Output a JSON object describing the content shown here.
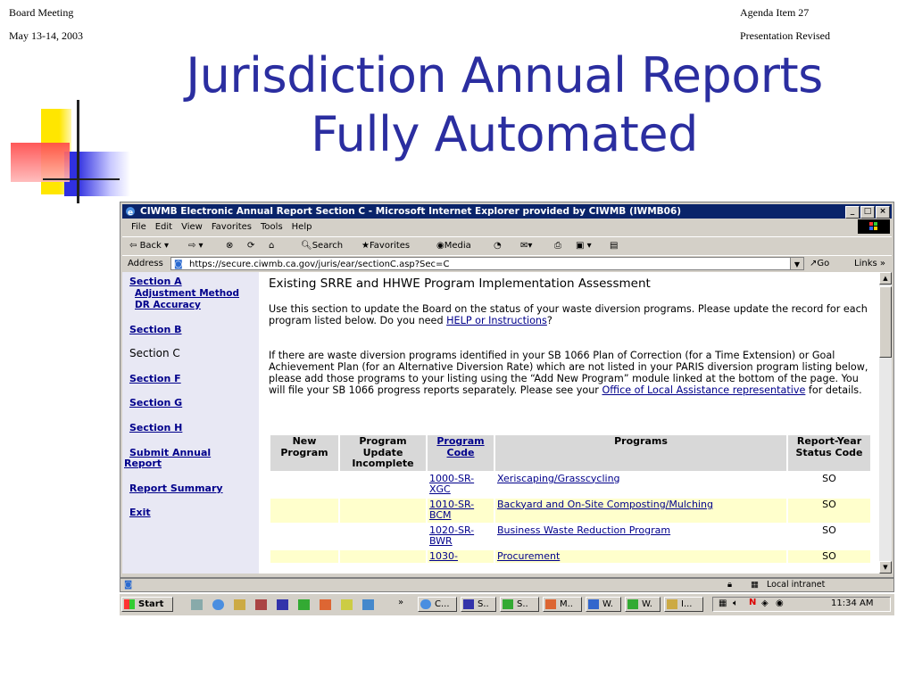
{
  "slide": {
    "header_left_line1": "Board Meeting",
    "header_left_line2": "May 13-14, 2003",
    "header_right_line1": "Agenda Item 27",
    "header_right_line2": "Presentation Revised",
    "title_line1": "Jurisdiction Annual Reports",
    "title_line2": "Fully Automated"
  },
  "colors": {
    "title": "#2b2ea0",
    "deco_yellow": "#ffe600",
    "deco_red": "#ff4a4a",
    "deco_blue": "#3030e0",
    "ie_titlebar": "#0a246a",
    "table_alt_row": "#ffffcc"
  },
  "browser": {
    "title": "CIWMB Electronic Annual Report Section C - Microsoft Internet Explorer provided by CIWMB (IWMB06)",
    "menu": [
      "File",
      "Edit",
      "View",
      "Favorites",
      "Tools",
      "Help"
    ],
    "toolbar": {
      "back": "Back",
      "search": "Search",
      "favorites": "Favorites",
      "media": "Media"
    },
    "address_label": "Address",
    "url": "https://secure.ciwmb.ca.gov/juris/ear/sectionC.asp?Sec=C",
    "go": "Go",
    "links": "Links"
  },
  "nav": {
    "section_a": "Section A",
    "adjustment_method": "Adjustment Method",
    "dr_accuracy": "DR Accuracy",
    "section_b": "Section B",
    "section_c": "Section C",
    "section_f": "Section F",
    "section_g": "Section G",
    "section_h": "Section H",
    "submit_line1": "Submit Annual",
    "submit_line2": "Report",
    "report_summary": "Report Summary",
    "exit": "Exit"
  },
  "main": {
    "heading": "Existing SRRE and HHWE Program Implementation Assessment",
    "p1_text": "Use this section to update the Board on the status of your waste diversion programs. Please update the record for each program listed below. Do you need ",
    "p1_link": "HELP or Instructions",
    "p1_end": "?",
    "p2_text": "If there are waste diversion programs identified in your SB 1066 Plan of Correction (for a Time Extension) or Goal Achievement Plan (for an Alternative Diversion Rate) which are not listed in your PARIS diversion program listing below, please add those programs to your listing using the “Add New Program” module linked at the bottom of the page. You will file your SB 1066 progress reports separately. Please see your ",
    "p2_link": "Office of Local Assistance representative",
    "p2_end": " for details."
  },
  "table": {
    "headers": [
      "New Program",
      "Program Update Incomplete",
      "Program Code",
      "Programs",
      "Report-Year Status Code"
    ],
    "rows": [
      {
        "code": "1000-SR-XGC",
        "program": "Xeriscaping/Grasscycling",
        "status": "SO"
      },
      {
        "code": "1010-SR-BCM",
        "program": "Backyard and On-Site Composting/Mulching",
        "status": "SO"
      },
      {
        "code": "1020-SR-BWR",
        "program": "Business Waste Reduction Program",
        "status": "SO"
      },
      {
        "code": "1030-",
        "program": "Procurement",
        "status": "SO"
      }
    ]
  },
  "status_bar": {
    "zone": "Local intranet"
  },
  "taskbar": {
    "start": "Start",
    "tasks": [
      "C...",
      "S..",
      "S..",
      "M..",
      "W.",
      "W.",
      "I..."
    ],
    "clock": "11:34 AM"
  }
}
